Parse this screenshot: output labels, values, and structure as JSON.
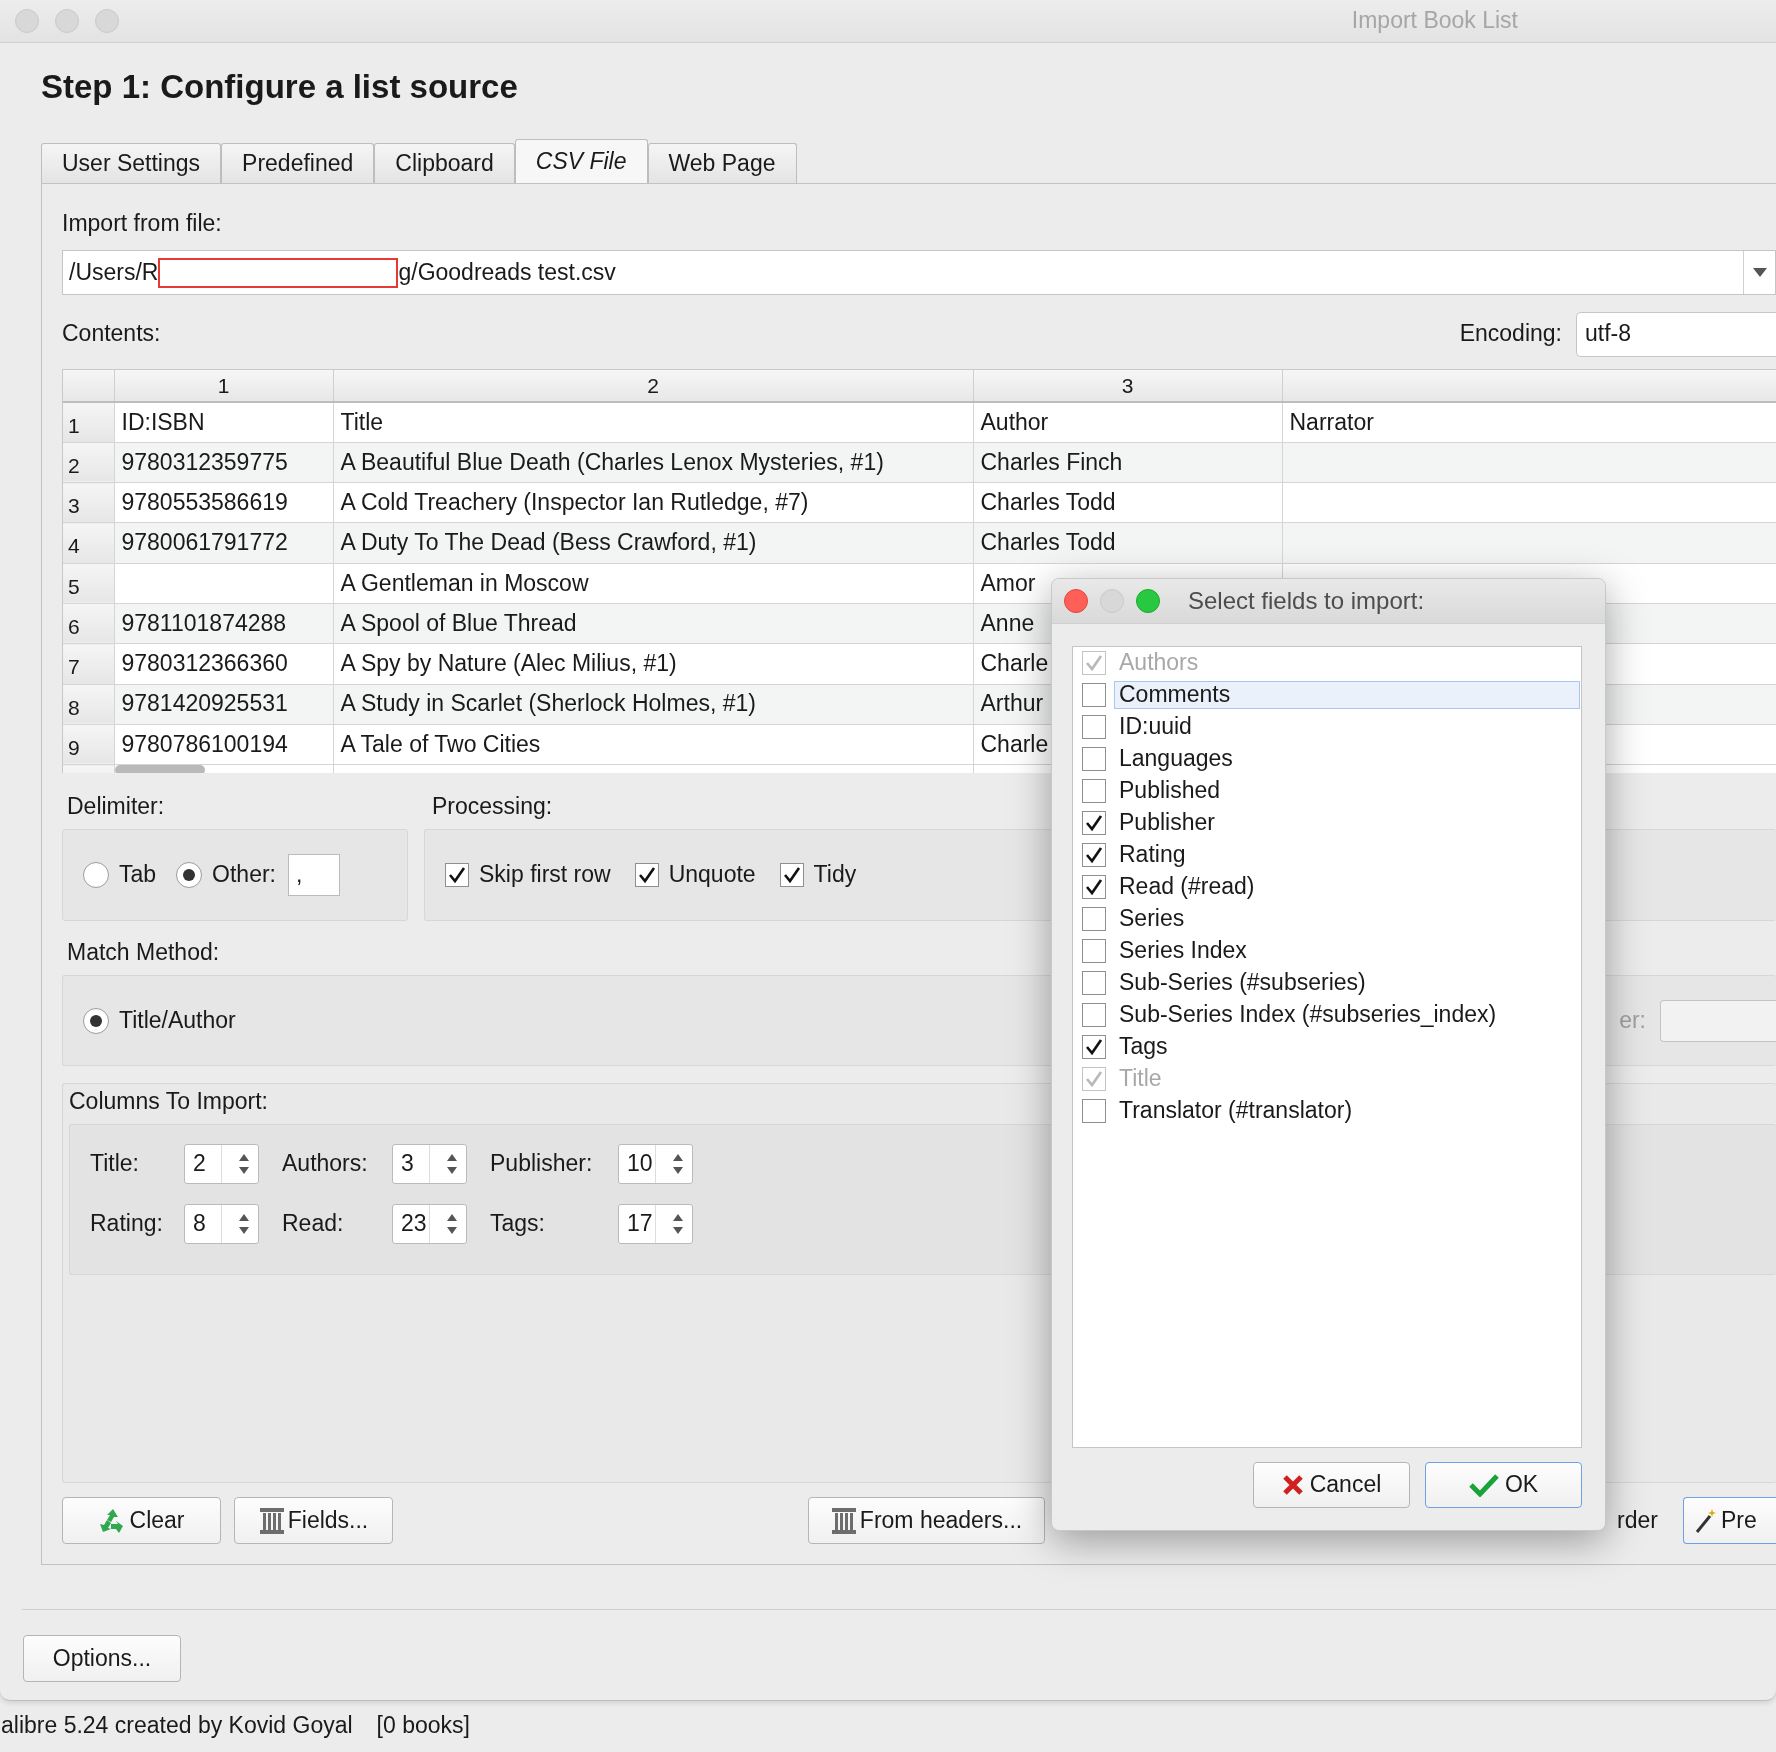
{
  "window": {
    "title": "Import Book List"
  },
  "heading": "Step 1: Configure a list source",
  "tabs": [
    {
      "label": "User Settings",
      "selected": false
    },
    {
      "label": "Predefined",
      "selected": false
    },
    {
      "label": "Clipboard",
      "selected": false
    },
    {
      "label": "CSV File",
      "selected": true
    },
    {
      "label": "Web Page",
      "selected": false
    }
  ],
  "file": {
    "label": "Import from file:",
    "path_start": "/Users/R",
    "path_end": "g/Goodreads test.csv"
  },
  "contents": {
    "label": "Contents:",
    "encoding_label": "Encoding:",
    "encoding": "utf-8"
  },
  "table": {
    "columns": [
      "1",
      "2",
      "3"
    ],
    "rows": [
      {
        "number": "1",
        "column_1": "ID:ISBN",
        "column_2": "Title",
        "column_3": "Author",
        "column_4": "Narrator"
      },
      {
        "number": "2",
        "column_1": "9780312359775",
        "column_2": "A Beautiful Blue Death (Charles Lenox Mysteries, #1)",
        "column_3": "Charles Finch"
      },
      {
        "number": "3",
        "column_1": "9780553586619",
        "column_2": "A Cold Treachery (Inspector Ian Rutledge, #7)",
        "column_3": "Charles Todd"
      },
      {
        "number": "4",
        "column_1": "9780061791772",
        "column_2": "A Duty To The Dead (Bess Crawford, #1)",
        "column_3": "Charles Todd"
      },
      {
        "number": "5",
        "column_2": "A Gentleman in Moscow",
        "column_3": "Amor"
      },
      {
        "number": "6",
        "column_1": "9781101874288",
        "column_2": "A Spool of Blue Thread",
        "column_3": "Anne"
      },
      {
        "number": "7",
        "column_1": "9780312366360",
        "column_2": "A Spy by Nature (Alec Milius, #1)",
        "column_3": "Charle"
      },
      {
        "number": "8",
        "column_1": "9781420925531",
        "column_2": "A Study in Scarlet (Sherlock Holmes, #1)",
        "column_3": "Arthur"
      },
      {
        "number": "9",
        "column_1": "9780786100194",
        "column_2": "A Tale of Two Cities",
        "column_3": "Charle"
      }
    ]
  },
  "delimiter": {
    "label": "Delimiter:",
    "options": [
      {
        "label": "Tab",
        "selected": false
      },
      {
        "label": "Other:",
        "selected": true
      }
    ],
    "other_value": ","
  },
  "processing": {
    "label": "Processing:",
    "options": [
      {
        "label": "Skip first row",
        "checked": true
      },
      {
        "label": "Unquote",
        "checked": true
      },
      {
        "label": "Tidy",
        "checked": true
      }
    ]
  },
  "match": {
    "label": "Match Method:",
    "options": [
      {
        "label": "Title/Author",
        "selected": true
      }
    ],
    "partial_label": "er:"
  },
  "columns_to_import": {
    "label": "Columns To Import:",
    "fields": [
      {
        "label": "Title:",
        "value": "2"
      },
      {
        "label": "Authors:",
        "value": "3"
      },
      {
        "label": "Publisher:",
        "value": "10"
      },
      {
        "label": "Rating:",
        "value": "8"
      },
      {
        "label": "Read:",
        "value": "23"
      },
      {
        "label": "Tags:",
        "value": "17"
      }
    ]
  },
  "bottom_buttons": [
    {
      "label": "Clear",
      "kind": "recycle"
    },
    {
      "label": "Fields...",
      "kind": "column"
    },
    {
      "label": "From headers...",
      "kind": "column"
    }
  ],
  "partial_label": "rder",
  "partial_button": {
    "label": "Pre",
    "kind": "wand"
  },
  "options_button": "Options...",
  "status_bar": [
    "alibre 5.24 created by Kovid Goyal",
    "[0 books]"
  ],
  "dialog": {
    "title": "Select fields to import:",
    "fields": [
      {
        "label": "Authors",
        "checked": true,
        "disabled": true,
        "selected": false
      },
      {
        "label": "Comments",
        "checked": false,
        "disabled": false,
        "selected": true
      },
      {
        "label": "ID:uuid",
        "checked": false,
        "disabled": false,
        "selected": false
      },
      {
        "label": "Languages",
        "checked": false,
        "disabled": false,
        "selected": false
      },
      {
        "label": "Published",
        "checked": false,
        "disabled": false,
        "selected": false
      },
      {
        "label": "Publisher",
        "checked": true,
        "disabled": false,
        "selected": false
      },
      {
        "label": "Rating",
        "checked": true,
        "disabled": false,
        "selected": false
      },
      {
        "label": "Read (#read)",
        "checked": true,
        "disabled": false,
        "selected": false
      },
      {
        "label": "Series",
        "checked": false,
        "disabled": false,
        "selected": false
      },
      {
        "label": "Series Index",
        "checked": false,
        "disabled": false,
        "selected": false
      },
      {
        "label": "Sub-Series (#subseries)",
        "checked": false,
        "disabled": false,
        "selected": false
      },
      {
        "label": "Sub-Series Index (#subseries_index)",
        "checked": false,
        "disabled": false,
        "selected": false
      },
      {
        "label": "Tags",
        "checked": true,
        "disabled": false,
        "selected": false
      },
      {
        "label": "Title",
        "checked": true,
        "disabled": true,
        "selected": false
      },
      {
        "label": "Translator (#translator)",
        "checked": false,
        "disabled": false,
        "selected": false
      }
    ],
    "buttons": [
      {
        "label": "Cancel",
        "kind": "cancel"
      },
      {
        "label": "OK",
        "kind": "ok"
      }
    ]
  }
}
